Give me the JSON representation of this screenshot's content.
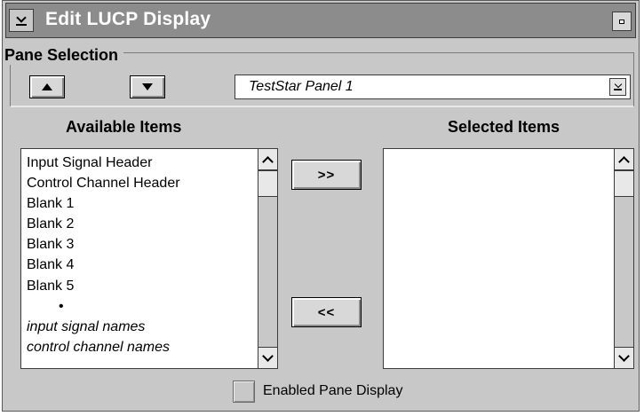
{
  "window": {
    "title": "Edit LUCP Display"
  },
  "pane_selection": {
    "legend": "Pane Selection",
    "selected_value": "TestStar Panel 1"
  },
  "available": {
    "header": "Available Items",
    "items": [
      "Input Signal Header",
      "Control Channel Header",
      "Blank 1",
      "Blank 2",
      "Blank 3",
      "Blank 4",
      "Blank 5",
      "•",
      "input signal names",
      "control channel names"
    ]
  },
  "selected": {
    "header": "Selected Items",
    "items": []
  },
  "buttons": {
    "add_label": ">>",
    "remove_label": "<<"
  },
  "enabled_pane_display": {
    "label": "Enabled Pane Display",
    "checked": false
  },
  "icons": [
    "window-menu-icon",
    "maximize-icon",
    "up-arrow-icon",
    "down-arrow-icon",
    "dropdown-icon",
    "scroll-up-icon",
    "scroll-down-icon"
  ]
}
